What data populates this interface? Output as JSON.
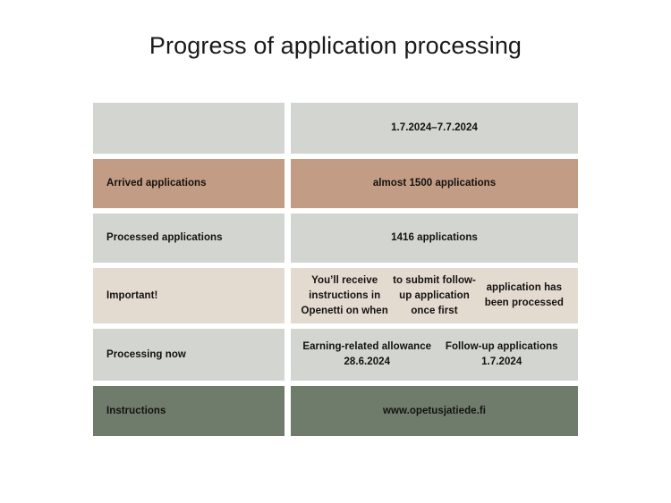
{
  "slide": {
    "title": "Progress of application processing",
    "background_color": "#ffffff",
    "text_color": "#14110f"
  },
  "colors": {
    "gray": "#d2d5d0",
    "tan": "#c29c85",
    "beige": "#e3dbd0",
    "green": "#6f7c6c"
  },
  "table": {
    "rows": [
      {
        "name": "period",
        "label": "",
        "value": "1.7.2024–7.7.2024",
        "color": "#d2d5d0"
      },
      {
        "name": "arrived",
        "label": "Arrived applications",
        "value": "almost 1500 applications",
        "color": "#c29c85"
      },
      {
        "name": "processed",
        "label": "Processed applications",
        "value": "1416 applications",
        "color": "#d2d5d0"
      },
      {
        "name": "important",
        "label": "Important!",
        "value_lines": [
          "You’ll receive instructions in Openetti on when",
          "to submit follow-up application once first",
          "application has been processed"
        ],
        "color": "#e3dbd0"
      },
      {
        "name": "processing",
        "label": "Processing now",
        "value_lines": [
          "Earning-related allowance 28.6.2024",
          "Follow-up applications 1.7.2024"
        ],
        "color": "#d2d5d0"
      },
      {
        "name": "instructions",
        "label": "Instructions",
        "value": "www.opetusjatiede.fi",
        "color": "#6f7c6c"
      }
    ]
  }
}
